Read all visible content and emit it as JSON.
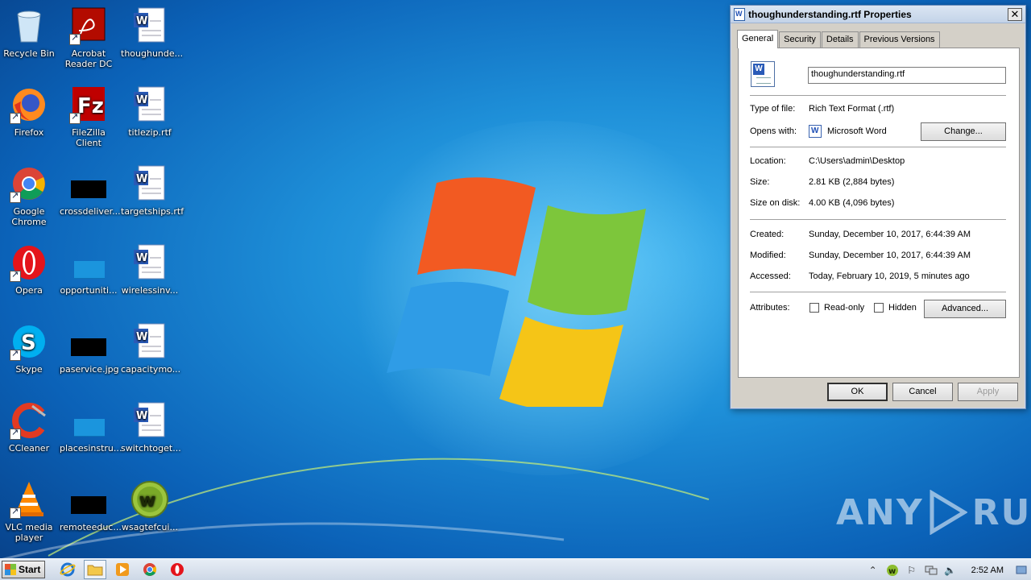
{
  "desktop": {
    "icons": [
      {
        "label": "Recycle Bin",
        "icon": "recycle-bin-icon"
      },
      {
        "label": "Acrobat Reader DC",
        "icon": "acrobat-icon"
      },
      {
        "label": "thoughunde...",
        "icon": "word-doc-icon"
      },
      {
        "label": "Firefox",
        "icon": "firefox-icon"
      },
      {
        "label": "FileZilla Client",
        "icon": "filezilla-icon"
      },
      {
        "label": "titlezip.rtf",
        "icon": "word-doc-icon"
      },
      {
        "label": "Google Chrome",
        "icon": "chrome-icon"
      },
      {
        "label": "crossdeliver...",
        "icon": "black-file-icon"
      },
      {
        "label": "targetships.rtf",
        "icon": "word-doc-icon"
      },
      {
        "label": "Opera",
        "icon": "opera-icon"
      },
      {
        "label": "opportuniti...",
        "icon": "blank-file-icon"
      },
      {
        "label": "wirelessinv...",
        "icon": "word-doc-icon"
      },
      {
        "label": "Skype",
        "icon": "skype-icon"
      },
      {
        "label": "paservice.jpg",
        "icon": "black-file-icon"
      },
      {
        "label": "capacitymo...",
        "icon": "word-doc-icon"
      },
      {
        "label": "CCleaner",
        "icon": "ccleaner-icon"
      },
      {
        "label": "placesinstru...",
        "icon": "blank-file-icon"
      },
      {
        "label": "switchtoget...",
        "icon": "word-doc-icon"
      },
      {
        "label": "VLC media player",
        "icon": "vlc-icon"
      },
      {
        "label": "remoteeduc...",
        "icon": "black-file-icon"
      },
      {
        "label": "wsagtefcui...",
        "icon": "w-green-icon"
      }
    ],
    "watermark": {
      "any": "ANY",
      "run": "RUN"
    }
  },
  "dialog": {
    "title": "thoughunderstanding.rtf Properties",
    "tabs": [
      "General",
      "Security",
      "Details",
      "Previous Versions"
    ],
    "active_tab": "General",
    "file_name": "thoughunderstanding.rtf",
    "type_label": "Type of file:",
    "type_value": "Rich Text Format (.rtf)",
    "opens_label": "Opens with:",
    "opens_value": "Microsoft Word",
    "change_button": "Change...",
    "location_label": "Location:",
    "location_value": "C:\\Users\\admin\\Desktop",
    "size_label": "Size:",
    "size_value": "2.81 KB (2,884 bytes)",
    "size_disk_label": "Size on disk:",
    "size_disk_value": "4.00 KB (4,096 bytes)",
    "created_label": "Created:",
    "created_value": "Sunday, December 10, 2017, 6:44:39 AM",
    "modified_label": "Modified:",
    "modified_value": "Sunday, December 10, 2017, 6:44:39 AM",
    "accessed_label": "Accessed:",
    "accessed_value": "Today, February 10, 2019, 5 minutes ago",
    "attributes_label": "Attributes:",
    "readonly_label": "Read-only",
    "readonly_checked": false,
    "hidden_label": "Hidden",
    "hidden_checked": false,
    "advanced_button": "Advanced...",
    "ok_button": "OK",
    "cancel_button": "Cancel",
    "apply_button": "Apply",
    "close_glyph": "✕"
  },
  "taskbar": {
    "start_label": "Start",
    "pinned": [
      "internet-explorer-icon",
      "folder-icon",
      "media-player-icon",
      "chrome-icon",
      "opera-icon"
    ],
    "clock": "2:52 AM"
  },
  "colors": {
    "accent": "#1e8fd8",
    "dialog_bg": "#d4d0c8"
  }
}
